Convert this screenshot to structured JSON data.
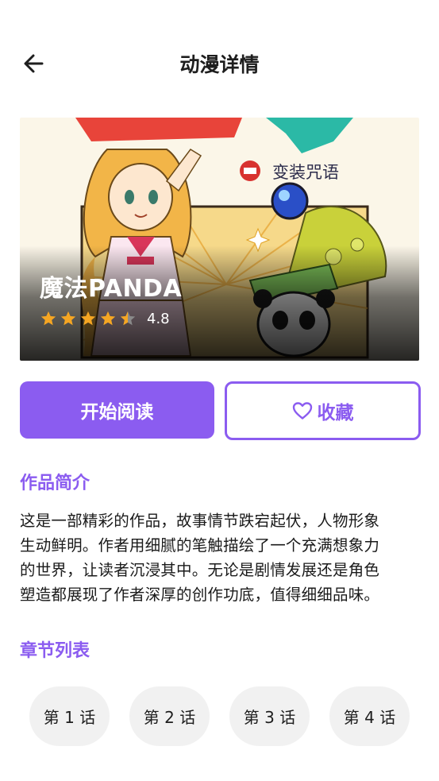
{
  "header": {
    "title": "动漫详情",
    "back_icon": "arrow-left-icon"
  },
  "hero": {
    "title": "魔法PANDA",
    "cover_caption": "变装咒语",
    "rating": 4.8,
    "rating_text": "4.8",
    "stars_max": 5,
    "star_color": "#f5a623"
  },
  "actions": {
    "read_label": "开始阅读",
    "favorite_label": "收藏",
    "favorite_icon": "heart-icon"
  },
  "intro": {
    "heading": "作品简介",
    "lines": [
      "这是一部精彩的作品，故事情节跌宕起伏，人物形象",
      "生动鲜明。作者用细腻的笔触描绘了一个充满想象力",
      "的世界，让读者沉浸其中。无论是剧情发展还是角色",
      "塑造都展现了作者深厚的创作功底，值得细细品味。"
    ]
  },
  "chapters": {
    "heading": "章节列表",
    "items": [
      "第 1 话",
      "第 2 话",
      "第 3 话",
      "第 4 话"
    ]
  },
  "colors": {
    "accent": "#8b5cf0",
    "chip_bg": "#f1f1f1"
  }
}
